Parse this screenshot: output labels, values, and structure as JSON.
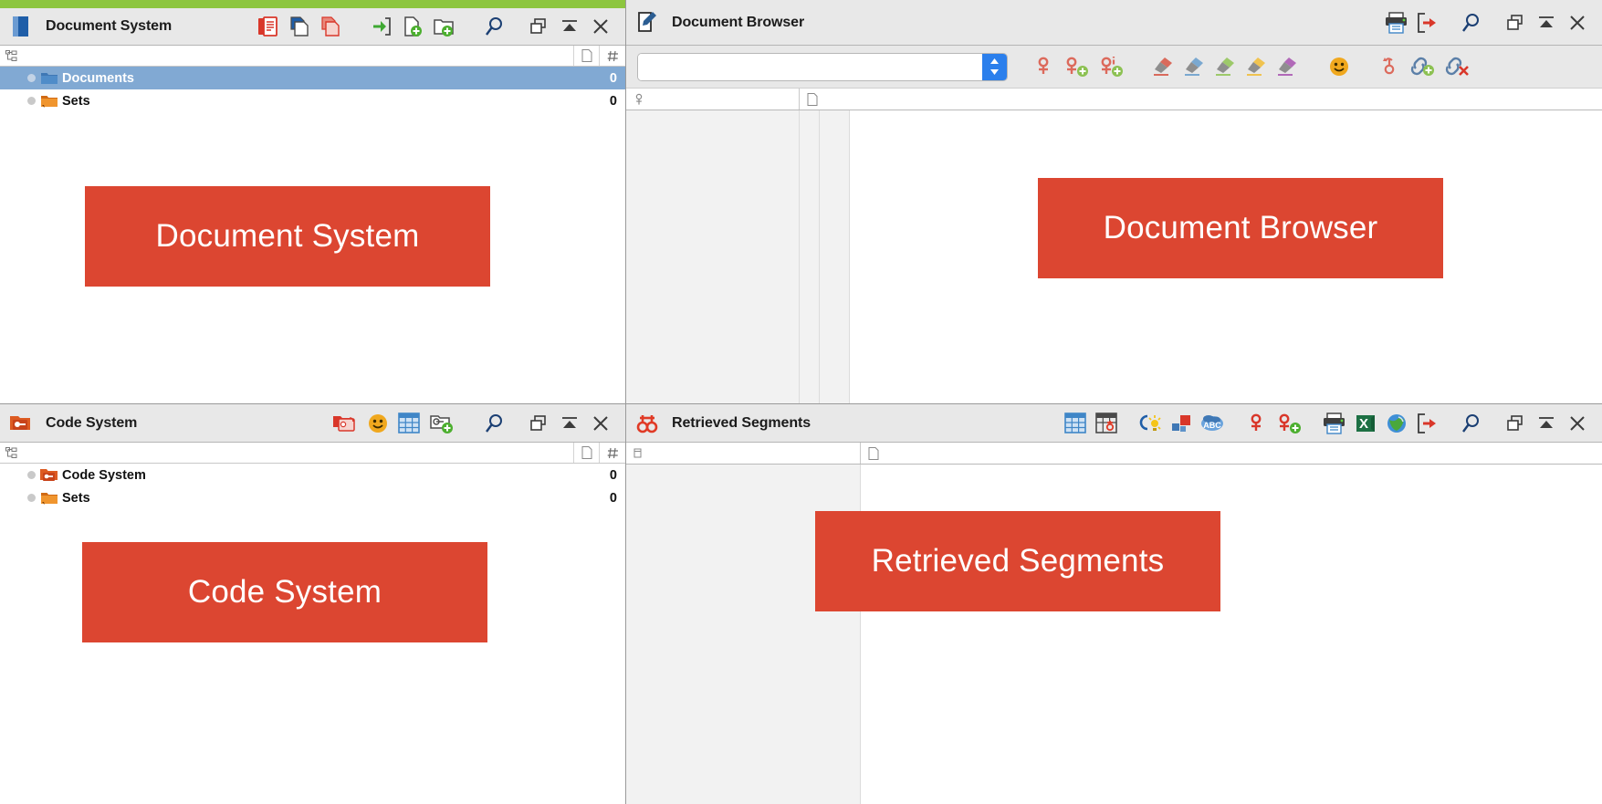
{
  "theme": {
    "accent_green": "#8dc63f",
    "banner_red": "#dc4631",
    "selection_blue": "#81a9d3",
    "toolbar_grey": "#e8e8e8",
    "spinner_blue": "#2b7fec"
  },
  "panels": {
    "document_system": {
      "title": "Document System",
      "icon": "document-stack-icon",
      "banner_label": "Document System",
      "columns": [
        {
          "name": "tree-column",
          "icon": "hierarchy-icon",
          "label": ""
        },
        {
          "name": "memo-column",
          "icon": "memo-page-icon",
          "label": ""
        },
        {
          "name": "count-column",
          "icon": "hash-icon",
          "label": ""
        }
      ],
      "toolbar": [
        {
          "name": "paste-document-button",
          "icon": "clipboard-paste-icon",
          "label": "Paste Document"
        },
        {
          "name": "copy-document-button",
          "icon": "copy-blue-icon",
          "label": "Copy Document"
        },
        {
          "name": "duplicate-document-button",
          "icon": "copy-red-icon",
          "label": "Duplicate Document"
        },
        {
          "name": "import-document-button",
          "icon": "import-arrow-icon",
          "label": "Import Document"
        },
        {
          "name": "new-document-button",
          "icon": "new-document-plus-icon",
          "label": "New Document"
        },
        {
          "name": "new-document-group-button",
          "icon": "new-folder-plus-icon",
          "label": "New Document Group"
        },
        {
          "name": "search-button",
          "icon": "magnifier-icon",
          "label": "Search"
        },
        {
          "name": "detach-window-button",
          "icon": "detach-window-icon",
          "label": "Detach"
        },
        {
          "name": "collapse-button",
          "icon": "collapse-up-icon",
          "label": "Collapse"
        },
        {
          "name": "close-button",
          "icon": "close-x-icon",
          "label": "Close"
        }
      ],
      "tree": [
        {
          "name": "tree-item-documents",
          "label": "Documents",
          "icon": "folder-blue-icon",
          "count": "0",
          "selected": true
        },
        {
          "name": "tree-item-sets",
          "label": "Sets",
          "icon": "folder-orange-icon",
          "count": "0",
          "selected": false
        }
      ]
    },
    "document_browser": {
      "title": "Document Browser",
      "icon": "edit-page-icon",
      "banner_label": "Document Browser",
      "search": {
        "value": "",
        "placeholder": ""
      },
      "columns": [
        {
          "name": "code-column",
          "icon": "code-node-icon",
          "label": ""
        },
        {
          "name": "memo-column",
          "icon": "memo-page-icon",
          "label": ""
        }
      ],
      "toolbar_top": [
        {
          "name": "print-button",
          "icon": "printer-icon",
          "label": "Print"
        },
        {
          "name": "export-button",
          "icon": "export-arrow-icon",
          "label": "Export"
        },
        {
          "name": "search-button",
          "icon": "magnifier-icon",
          "label": "Search"
        },
        {
          "name": "detach-window-button",
          "icon": "detach-window-icon",
          "label": "Detach"
        },
        {
          "name": "collapse-button",
          "icon": "collapse-up-icon",
          "label": "Collapse"
        },
        {
          "name": "close-button",
          "icon": "close-x-icon",
          "label": "Close"
        }
      ],
      "toolbar_tools": [
        {
          "name": "code-in-vivo-button",
          "icon": "code-node-red-icon",
          "label": "Code In Vivo"
        },
        {
          "name": "new-code-button",
          "icon": "code-node-plus-icon",
          "label": "New Code"
        },
        {
          "name": "new-code-with-info-button",
          "icon": "code-node-info-plus-icon",
          "label": "New Code With Info"
        },
        {
          "name": "highlight-red-button",
          "icon": "highlighter-red-icon",
          "label": "Highlight Red"
        },
        {
          "name": "highlight-blue-button",
          "icon": "highlighter-blue-icon",
          "label": "Highlight Blue"
        },
        {
          "name": "highlight-green-button",
          "icon": "highlighter-green-icon",
          "label": "Highlight Green"
        },
        {
          "name": "highlight-yellow-button",
          "icon": "highlighter-yellow-icon",
          "label": "Highlight Yellow"
        },
        {
          "name": "highlight-magenta-button",
          "icon": "highlighter-magenta-icon",
          "label": "Highlight Magenta"
        },
        {
          "name": "emoticode-button",
          "icon": "smiley-icon",
          "label": "Emoticode"
        },
        {
          "name": "undo-coding-button",
          "icon": "undo-code-icon",
          "label": "Undo Coding"
        },
        {
          "name": "add-link-button",
          "icon": "link-plus-icon",
          "label": "Add Link"
        },
        {
          "name": "delete-link-button",
          "icon": "link-delete-icon",
          "label": "Delete Link"
        }
      ]
    },
    "code_system": {
      "title": "Code System",
      "icon": "code-folder-icon",
      "banner_label": "Code System",
      "columns": [
        {
          "name": "tree-column",
          "icon": "hierarchy-icon",
          "label": ""
        },
        {
          "name": "memo-column",
          "icon": "memo-page-icon",
          "label": ""
        },
        {
          "name": "count-column",
          "icon": "hash-icon",
          "label": ""
        }
      ],
      "toolbar": [
        {
          "name": "paste-code-button",
          "icon": "code-paste-red-icon",
          "label": "Paste Code"
        },
        {
          "name": "emoticode-button",
          "icon": "smiley-icon",
          "label": "Emoticode"
        },
        {
          "name": "code-matrix-button",
          "icon": "grid-blue-icon",
          "label": "Code Matrix"
        },
        {
          "name": "new-code-button",
          "icon": "new-code-plus-icon",
          "label": "New Code"
        },
        {
          "name": "search-button",
          "icon": "magnifier-icon",
          "label": "Search"
        },
        {
          "name": "detach-window-button",
          "icon": "detach-window-icon",
          "label": "Detach"
        },
        {
          "name": "collapse-button",
          "icon": "collapse-up-icon",
          "label": "Collapse"
        },
        {
          "name": "close-button",
          "icon": "close-x-icon",
          "label": "Close"
        }
      ],
      "tree": [
        {
          "name": "tree-item-code-system",
          "label": "Code System",
          "icon": "code-folder-icon",
          "count": "0",
          "selected": false
        },
        {
          "name": "tree-item-sets",
          "label": "Sets",
          "icon": "folder-orange-icon",
          "count": "0",
          "selected": false
        }
      ]
    },
    "retrieved_segments": {
      "title": "Retrieved Segments",
      "icon": "retrieved-segments-icon",
      "banner_label": "Retrieved Segments",
      "columns": [
        {
          "name": "segment-column",
          "icon": "segment-icon",
          "label": ""
        },
        {
          "name": "memo-column",
          "icon": "memo-page-icon",
          "label": ""
        }
      ],
      "toolbar": [
        {
          "name": "overview-table-button",
          "icon": "grid-blue-icon",
          "label": "Overview Table"
        },
        {
          "name": "coded-segments-table-button",
          "icon": "grid-code-icon",
          "label": "Coded Segments Table"
        },
        {
          "name": "summary-button",
          "icon": "lightbulb-idea-icon",
          "label": "Summary"
        },
        {
          "name": "color-blocks-button",
          "icon": "color-blocks-icon",
          "label": "Color Blocks"
        },
        {
          "name": "paraphrase-button",
          "icon": "abc-cloud-icon",
          "label": "Paraphrase"
        },
        {
          "name": "code-button",
          "icon": "code-node-red-icon",
          "label": "Code"
        },
        {
          "name": "new-code-button",
          "icon": "code-node-plus-icon",
          "label": "New Code"
        },
        {
          "name": "print-button",
          "icon": "printer-icon",
          "label": "Print"
        },
        {
          "name": "excel-export-button",
          "icon": "excel-icon",
          "label": "Export to Excel"
        },
        {
          "name": "html-export-button",
          "icon": "globe-icon",
          "label": "Export to HTML"
        },
        {
          "name": "export-button",
          "icon": "export-arrow-icon",
          "label": "Export"
        },
        {
          "name": "search-button",
          "icon": "magnifier-icon",
          "label": "Search"
        },
        {
          "name": "detach-window-button",
          "icon": "detach-window-icon",
          "label": "Detach"
        },
        {
          "name": "collapse-button",
          "icon": "collapse-up-icon",
          "label": "Collapse"
        },
        {
          "name": "close-button",
          "icon": "close-x-icon",
          "label": "Close"
        }
      ]
    }
  }
}
